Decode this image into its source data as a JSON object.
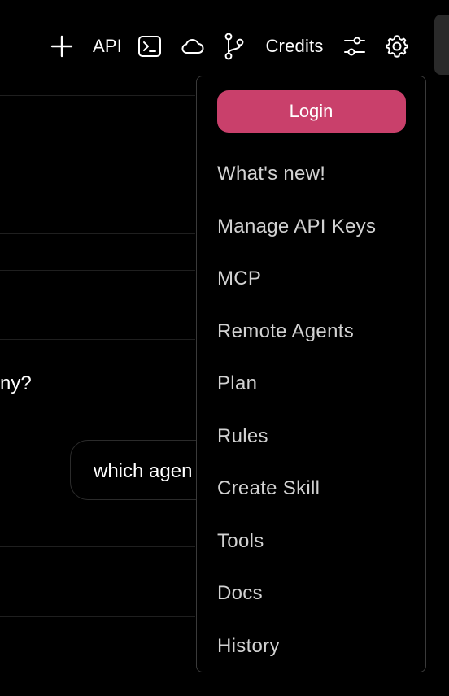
{
  "toolbar": {
    "new_icon": "plus-icon",
    "api_label": "API",
    "terminal_icon": "terminal-icon",
    "cloud_icon": "cloud-icon",
    "branch_icon": "git-branch-icon",
    "credits_label": "Credits",
    "sliders_icon": "sliders-icon",
    "settings_icon": "gear-icon"
  },
  "background": {
    "partial_text": "ny?",
    "chat_bubble_text": "which agen"
  },
  "menu": {
    "login_label": "Login",
    "items": [
      {
        "label": "What's new!"
      },
      {
        "label": "Manage API Keys"
      },
      {
        "label": "MCP"
      },
      {
        "label": "Remote Agents"
      },
      {
        "label": "Plan"
      },
      {
        "label": "Rules"
      },
      {
        "label": "Create Skill"
      },
      {
        "label": "Tools"
      },
      {
        "label": "Docs"
      },
      {
        "label": "History"
      }
    ]
  },
  "colors": {
    "background": "#000000",
    "accent": "#c9406b",
    "menu_border": "#3a3a3a",
    "menu_text": "#d2d2d2"
  }
}
